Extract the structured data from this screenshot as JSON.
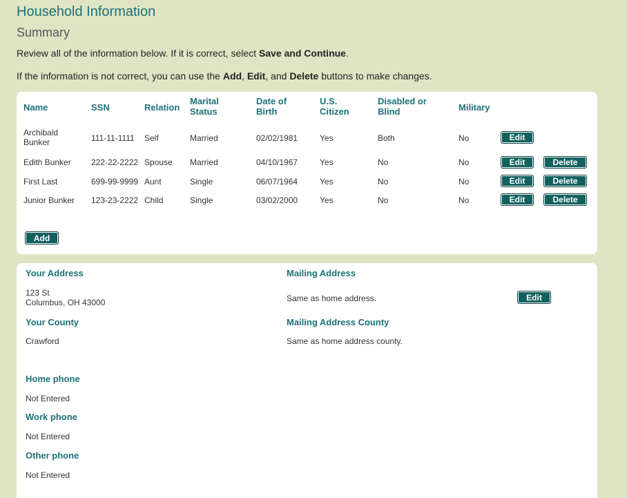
{
  "header": {
    "title": "Household Information",
    "subtitle": "Summary",
    "instruction1": {
      "prefix": "Review all of the information below. If it is correct, select ",
      "bold": "Save and Continue",
      "suffix": "."
    },
    "instruction2": {
      "prefix": "If the information is not correct, you can use the ",
      "add": "Add",
      "sep1": ", ",
      "edit": "Edit",
      "sep2": ", and ",
      "delete": "Delete",
      "suffix": " buttons to make changes."
    }
  },
  "members": {
    "columns": {
      "name": "Name",
      "ssn": "SSN",
      "relation": "Relation",
      "marital_1": "Marital",
      "marital_2": "Status",
      "dob_1": "Date of",
      "dob_2": "Birth",
      "citizen_1": "U.S.",
      "citizen_2": "Citizen",
      "disabled_1": "Disabled or",
      "disabled_2": "Blind",
      "military": "Military"
    },
    "rows": [
      {
        "name_1": "Archibald",
        "name_2": "Bunker",
        "ssn": "111-11-1111",
        "relation": "Self",
        "marital": "Married",
        "dob": "02/02/1981",
        "citizen": "Yes",
        "disabled": "Both",
        "military": "No",
        "edit": "Edit"
      },
      {
        "name_1": "Edith Bunker",
        "ssn": "222-22-2222",
        "relation": "Spouse",
        "marital": "Married",
        "dob": "04/10/1967",
        "citizen": "Yes",
        "disabled": "No",
        "military": "No",
        "edit": "Edit",
        "delete": "Delete"
      },
      {
        "name_1": "First Last",
        "ssn": "699-99-9999",
        "relation": "Aunt",
        "marital": "Single",
        "dob": "06/07/1964",
        "citizen": "Yes",
        "disabled": "No",
        "military": "No",
        "edit": "Edit",
        "delete": "Delete"
      },
      {
        "name_1": "Junior Bunker",
        "ssn": "123-23-2222",
        "relation": "Child",
        "marital": "Single",
        "dob": "03/02/2000",
        "citizen": "Yes",
        "disabled": "No",
        "military": "No",
        "edit": "Edit",
        "delete": "Delete"
      }
    ],
    "add_label": "Add"
  },
  "contact": {
    "your_address": {
      "label": "Your Address",
      "line1": "123 St",
      "line2": "Columbus, OH 43000"
    },
    "mailing_address": {
      "label": "Mailing Address",
      "value": "Same as home address."
    },
    "edit_label": "Edit",
    "your_county": {
      "label": "Your County",
      "value": "Crawford"
    },
    "mailing_county": {
      "label": "Mailing Address County",
      "value": "Same as home address county."
    },
    "home_phone": {
      "label": "Home phone",
      "value": "Not Entered"
    },
    "work_phone": {
      "label": "Work phone",
      "value": "Not Entered"
    },
    "other_phone": {
      "label": "Other phone",
      "value": "Not Entered"
    }
  }
}
